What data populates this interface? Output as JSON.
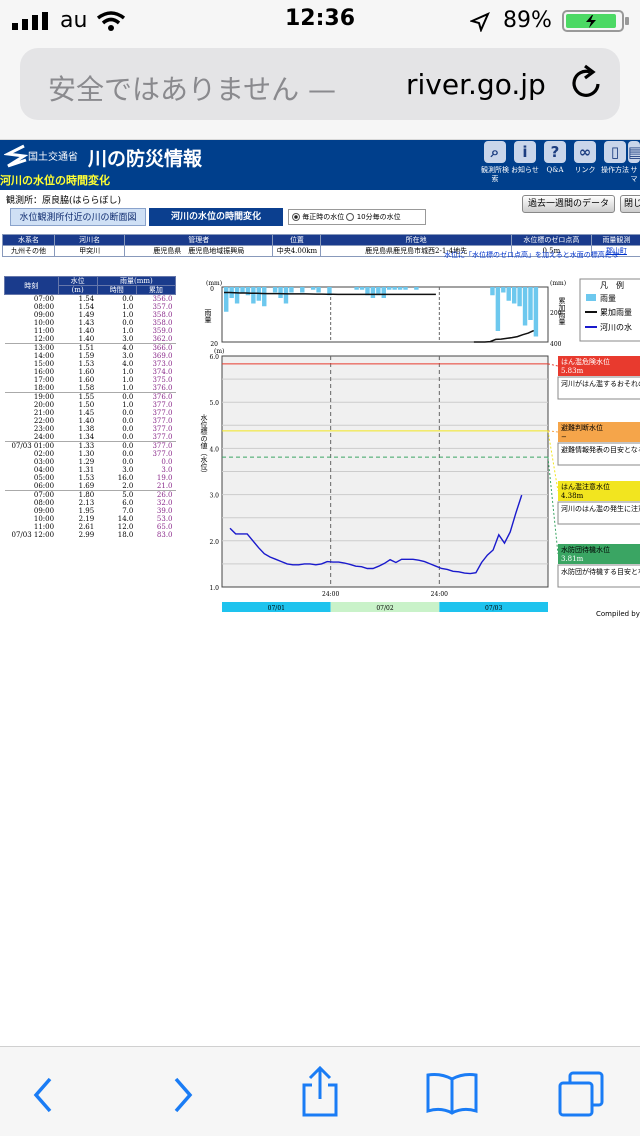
{
  "status": {
    "carrier": "au",
    "time": "12:36",
    "battery": "89%"
  },
  "address": {
    "insecure_text": "安全ではありません —",
    "domain": "river.go.jp"
  },
  "banner": {
    "ministry": "国土交通省",
    "site_name": "川の防災情報",
    "page_subtitle": "河川の水位の時間変化"
  },
  "nav": [
    {
      "label": "観測所検索",
      "icon": "search-icon"
    },
    {
      "label": "お知らせ",
      "icon": "info-icon"
    },
    {
      "label": "Q&A",
      "icon": "question-icon"
    },
    {
      "label": "リンク",
      "icon": "link-icon"
    },
    {
      "label": "操作方法",
      "icon": "mouse-icon"
    },
    {
      "label": "サマ",
      "icon": "sitemap-icon"
    }
  ],
  "station": {
    "label": "観測所：原良脇(はららぼし)"
  },
  "tabs": {
    "section_view": "水位観測所付近の川の断面図",
    "time_change": "河川の水位の時間変化"
  },
  "mode": {
    "option_hourly": "毎正時の水位",
    "option_10min": "10分毎の水位"
  },
  "buttons": {
    "past_week": "過去一週間のデータ",
    "close": "閉じ"
  },
  "info": {
    "headers": [
      "水系名",
      "河川名",
      "管理者",
      "位置",
      "所在地",
      "水位標のゼロ点高",
      "雨量観測"
    ],
    "values": [
      "九州その他",
      "甲突川",
      "鹿児島県　鹿児島地域振興局",
      "中央4.00km",
      "鹿児島県鹿児島市城西2-1-4地先",
      "0.5m",
      "郡山町"
    ]
  },
  "note": "水位に「水位標のゼロ点高」を加えると水面の標高にな",
  "datatable": {
    "col_time": "時刻",
    "col_level": "水位",
    "col_level_unit": "(m)",
    "col_rain": "雨量(mm)",
    "col_rain_hourly": "時間",
    "col_rain_cum": "累加",
    "rows": [
      [
        "07:00",
        "1.54",
        "0.0",
        "356.0"
      ],
      [
        "08:00",
        "1.54",
        "1.0",
        "357.0"
      ],
      [
        "09:00",
        "1.49",
        "1.0",
        "358.0"
      ],
      [
        "10:00",
        "1.43",
        "0.0",
        "358.0"
      ],
      [
        "11:00",
        "1.40",
        "1.0",
        "359.0"
      ],
      [
        "12:00",
        "1.40",
        "3.0",
        "362.0"
      ],
      [
        "13:00",
        "1.51",
        "4.0",
        "366.0"
      ],
      [
        "14:00",
        "1.59",
        "3.0",
        "369.0"
      ],
      [
        "15:00",
        "1.53",
        "4.0",
        "373.0"
      ],
      [
        "16:00",
        "1.60",
        "1.0",
        "374.0"
      ],
      [
        "17:00",
        "1.60",
        "1.0",
        "375.0"
      ],
      [
        "18:00",
        "1.58",
        "1.0",
        "376.0"
      ],
      [
        "19:00",
        "1.55",
        "0.0",
        "376.0"
      ],
      [
        "20:00",
        "1.50",
        "1.0",
        "377.0"
      ],
      [
        "21:00",
        "1.45",
        "0.0",
        "377.0"
      ],
      [
        "22:00",
        "1.40",
        "0.0",
        "377.0"
      ],
      [
        "23:00",
        "1.38",
        "0.0",
        "377.0"
      ],
      [
        "24:00",
        "1.34",
        "0.0",
        "377.0"
      ],
      [
        "07/03 01:00",
        "1.33",
        "0.0",
        "377.0"
      ],
      [
        "02:00",
        "1.30",
        "0.0",
        "377.0"
      ],
      [
        "03:00",
        "1.29",
        "0.0",
        "0.0"
      ],
      [
        "04:00",
        "1.31",
        "3.0",
        "3.0"
      ],
      [
        "05:00",
        "1.53",
        "16.0",
        "19.0"
      ],
      [
        "06:00",
        "1.69",
        "2.0",
        "21.0"
      ],
      [
        "07:00",
        "1.80",
        "5.0",
        "26.0"
      ],
      [
        "08:00",
        "2.13",
        "6.0",
        "32.0"
      ],
      [
        "09:00",
        "1.95",
        "7.0",
        "39.0"
      ],
      [
        "10:00",
        "2.19",
        "14.0",
        "53.0"
      ],
      [
        "11:00",
        "2.61",
        "12.0",
        "65.0"
      ],
      [
        "07/03 12:00",
        "2.99",
        "18.0",
        "83.0"
      ]
    ]
  },
  "legend": {
    "title": "凡　例",
    "rain": "雨量",
    "cum_rain": "累加雨量",
    "river_level": "河川の水"
  },
  "thresholds": [
    {
      "name": "はん濫危険水位",
      "value": "5.83m",
      "desc": "河川がはん濫するおそれのある水位",
      "color": "#e83a2e"
    },
    {
      "name": "避難判断水位",
      "value": "−",
      "desc": "避難情報発表の目安となる水位",
      "color": "#f5a54a"
    },
    {
      "name": "はん濫注意水位",
      "value": "4.38m",
      "desc": "河川のはん濫の発生に注意する水位",
      "color": "#f2e51f"
    },
    {
      "name": "水防団待機水位",
      "value": "3.81m",
      "desc": "水防団が待機する目安となる水位",
      "color": "#3aa563"
    }
  ],
  "chart_data": {
    "type": "line",
    "rain_axis": {
      "left_label": "雨量",
      "left_unit": "(mm)",
      "left_ticks": [
        "0",
        "20"
      ],
      "right_label": "累加雨量",
      "right_unit": "(mm)",
      "right_ticks": [
        "400",
        "200"
      ]
    },
    "level_axis": {
      "label": "水位標の値（水位）",
      "unit": "(m)",
      "ylim": [
        1.0,
        6.0
      ],
      "ticks": [
        "1.0",
        "2.0",
        "3.0",
        "4.0",
        "5.0",
        "6.0"
      ]
    },
    "x_labels": [
      "24:00",
      "24:00"
    ],
    "date_bands": [
      "07/01",
      "07/02",
      "07/03"
    ],
    "water_level": [
      2.27,
      2.15,
      2.15,
      2.15,
      2.0,
      1.85,
      1.72,
      1.65,
      1.6,
      1.55,
      1.5,
      1.48,
      1.48,
      1.5,
      1.5,
      1.48,
      1.5,
      1.55,
      1.54,
      1.54,
      1.52,
      1.49,
      1.45,
      1.44,
      1.4,
      1.4,
      1.45,
      1.51,
      1.59,
      1.53,
      1.6,
      1.6,
      1.6,
      1.58,
      1.55,
      1.5,
      1.45,
      1.4,
      1.38,
      1.34,
      1.33,
      1.3,
      1.29,
      1.31,
      1.53,
      1.69,
      1.8,
      2.13,
      1.95,
      2.19,
      2.61,
      2.99
    ],
    "thresholds": [
      5.83,
      4.38,
      3.81
    ],
    "cum_rain": [
      360,
      360,
      358,
      356,
      356,
      355,
      354,
      353,
      352,
      352,
      352,
      351,
      350,
      350,
      350,
      350,
      349,
      348,
      348,
      347,
      347,
      346,
      346,
      346,
      346,
      346,
      346,
      346,
      346,
      346,
      346,
      346,
      346,
      346,
      346,
      346,
      346,
      346,
      346,
      346,
      0,
      0,
      0,
      3,
      19,
      21,
      26,
      32,
      39,
      53,
      65,
      83
    ],
    "hourly_rain": [
      9,
      4,
      6,
      2,
      3,
      6,
      5,
      7,
      0,
      2,
      4,
      6,
      2,
      0,
      2,
      0,
      1,
      2,
      0,
      3,
      0,
      0,
      0,
      0,
      1,
      1,
      3,
      4,
      3,
      4,
      1,
      1,
      1,
      1,
      0,
      1,
      0,
      0,
      0,
      0,
      0,
      0,
      0,
      3,
      16,
      2,
      5,
      6,
      7,
      14,
      12,
      18
    ]
  },
  "compiled": "Compiled by",
  "toolbar": {
    "back": "back",
    "forward": "forward",
    "share": "share",
    "bookmarks": "bookmarks",
    "tabs": "tabs"
  }
}
